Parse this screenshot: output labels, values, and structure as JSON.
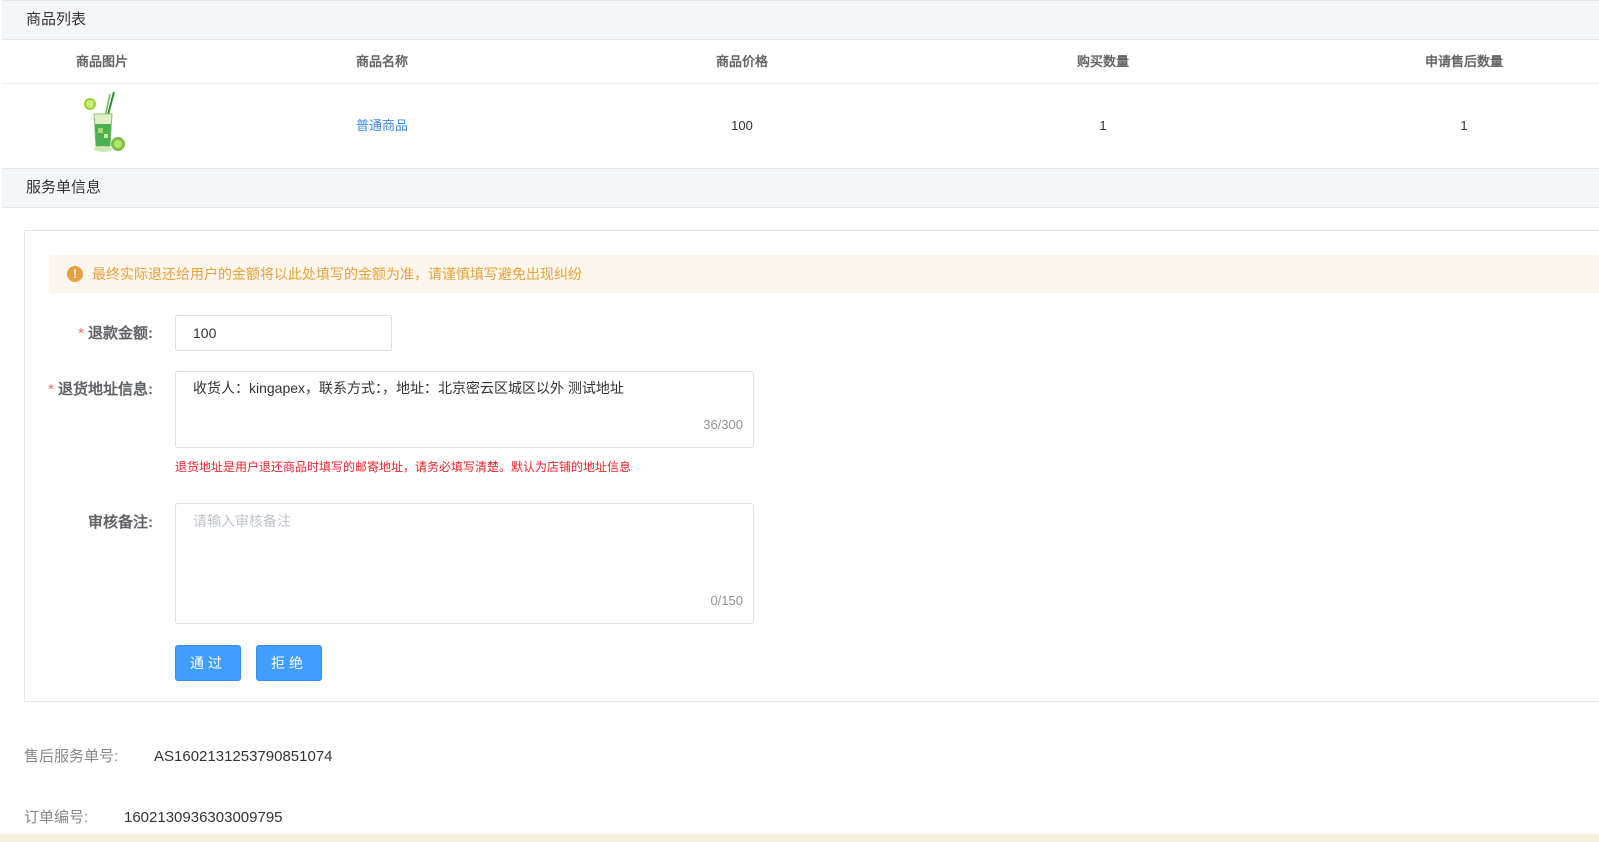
{
  "goods": {
    "title": "商品列表",
    "columns": [
      "商品图片",
      "商品名称",
      "商品价格",
      "购买数量",
      "申请售后数量"
    ],
    "row": {
      "name": "普通商品",
      "price": "100",
      "quantity": "1",
      "aftersale_quantity": "1"
    }
  },
  "service": {
    "title": "服务单信息",
    "alert": "最终实际退还给用户的金额将以此处填写的金额为准，请谨慎填写避免出现纠纷",
    "refund": {
      "label": "退款金额:",
      "value": "100"
    },
    "address": {
      "label": "退货地址信息:",
      "value": "收货人：kingapex，联系方式：，地址：北京密云区城区以外 测试地址",
      "counter": "36/300",
      "hint": "退货地址是用户退还商品时填写的邮寄地址，请务必填写清楚。默认为店铺的地址信息"
    },
    "remark": {
      "label": "审核备注:",
      "placeholder": "请输入审核备注",
      "counter": "0/150"
    },
    "approve_label": "通过",
    "reject_label": "拒绝"
  },
  "info": {
    "service_no_label": "售后服务单号:",
    "service_no": "AS1602131253790851074",
    "order_no_label": "订单编号:",
    "order_no": "1602130936303009795"
  },
  "colors": {
    "primary": "#409eff",
    "warning": "#e6a23c",
    "danger": "#f5222d",
    "link": "#3a8ee6"
  }
}
